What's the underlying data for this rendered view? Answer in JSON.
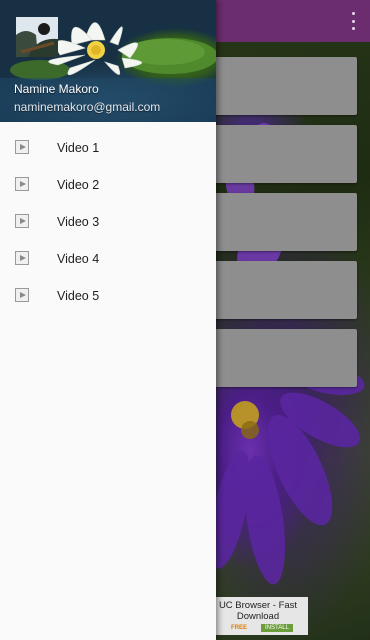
{
  "app_bar": {
    "overflow_icon": "more-vert-icon",
    "color": "#6b2d6e"
  },
  "drawer": {
    "header": {
      "name": "Namine Makoro",
      "email": "naminemakoro@gmail.com",
      "avatar_icon": "avatar-icon"
    },
    "items": [
      {
        "label": "Video 1",
        "icon": "play-icon"
      },
      {
        "label": "Video 2",
        "icon": "play-icon"
      },
      {
        "label": "Video 3",
        "icon": "play-icon"
      },
      {
        "label": "Video 4",
        "icon": "play-icon"
      },
      {
        "label": "Video 5",
        "icon": "play-icon"
      }
    ]
  },
  "ad": {
    "title": "UC Browser - Fast Download",
    "price": "FREE",
    "cta": "INSTALL"
  }
}
